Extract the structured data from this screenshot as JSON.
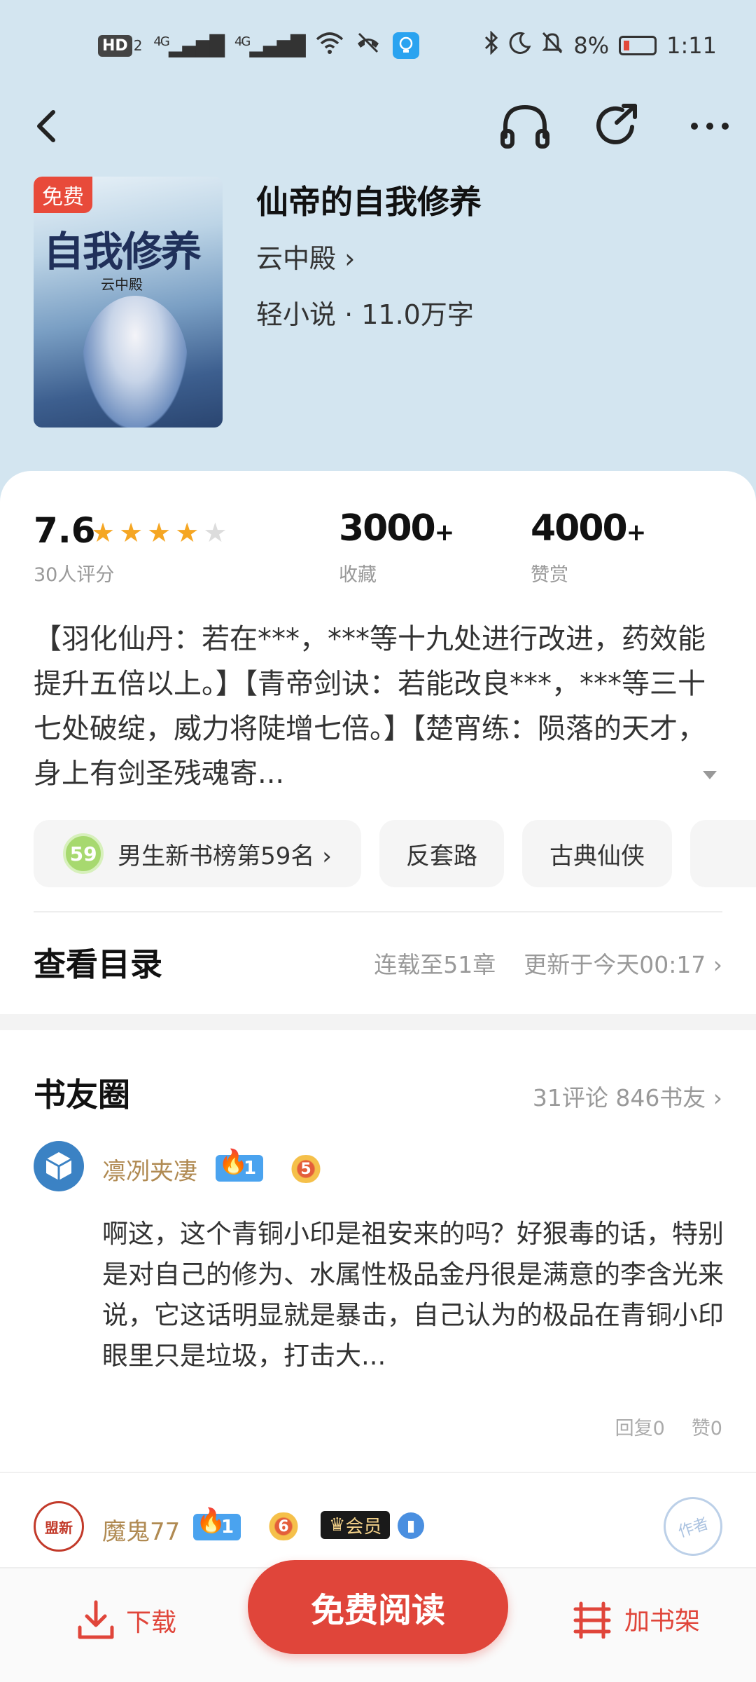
{
  "status_bar": {
    "hd": "HD",
    "hd_sub": "2",
    "signal1": "4G",
    "signal2": "4G",
    "battery": "8%",
    "time": "1:11"
  },
  "book": {
    "cover_badge": "免费",
    "cover_title": "自我修养",
    "cover_author": "云中殿",
    "title": "仙帝的自我修养",
    "author": "云中殿 ›",
    "meta": "轻小说 · 11.0万字"
  },
  "stats": {
    "rating": "7.6",
    "rating_stars": 4,
    "rating_count": "30人评分",
    "favorites": "3000",
    "favorites_label": "收藏",
    "rewards": "4000",
    "rewards_label": "赞赏",
    "plus": "+"
  },
  "intro": "【羽化仙丹：若在***，***等十九处进行改进，药效能提升五倍以上。】【青帝剑诀：若能改良***，***等三十七处破绽，威力将陡增七倍。】【楚宵练：陨落的天才，身上有剑圣残魂寄...",
  "tags": [
    {
      "rank": "59",
      "label": "男生新书榜第59名 ›"
    },
    {
      "label": "反套路"
    },
    {
      "label": "古典仙侠"
    }
  ],
  "toc": {
    "title": "查看目录",
    "chapters": "连载至51章",
    "updated": "更新于今天00:17 ›"
  },
  "circle": {
    "title": "书友圈",
    "info": "31评论 846书友 ›",
    "comments": [
      {
        "user": "凛冽夹凄",
        "fan_level": "1",
        "crown_level": "5",
        "text": "啊这，这个青铜小印是祖安来的吗？好狠毒的话，特别是对自己的修为、水属性极品金丹很是满意的李含光来说，它这话明显就是暴击，自己认为的极品在青铜小印眼里只是垃圾，打击大...",
        "reply": "回复0",
        "like": "赞0"
      },
      {
        "user": "魔鬼77",
        "avatar_text": "盟新",
        "fan_level": "1",
        "crown_level": "6",
        "vip": "会员",
        "stamp": "作者"
      }
    ]
  },
  "bottom": {
    "download": "下载",
    "read": "免费阅读",
    "add_shelf": "加书架"
  },
  "colors": {
    "accent": "#e0453a",
    "header_bg": "#d3e5f0",
    "star": "#f5a623",
    "username": "#b08a52"
  }
}
